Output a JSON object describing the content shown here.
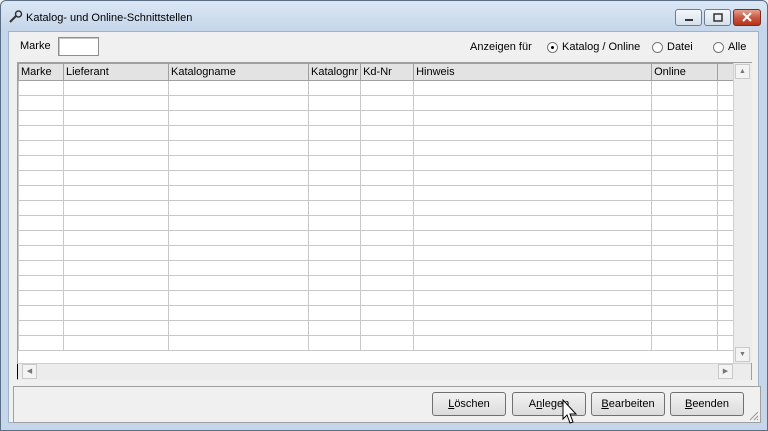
{
  "window": {
    "title": "Katalog- und Online-Schnittstellen"
  },
  "filter": {
    "marke_label": "Marke",
    "anzeigen_label": "Anzeigen für",
    "options": [
      {
        "label": "Katalog / Online",
        "checked": true
      },
      {
        "label": "Datei",
        "checked": false
      },
      {
        "label": "Alle",
        "checked": false
      }
    ]
  },
  "table": {
    "columns": [
      "Marke",
      "Lieferant",
      "Katalogname",
      "Katalognr",
      "Kd-Nr",
      "Hinweis",
      "Online",
      ""
    ],
    "row_count": 18
  },
  "buttons": {
    "loeschen": {
      "first": "L",
      "rest": "öschen"
    },
    "anlegen": {
      "pre": "A",
      "u": "n",
      "rest": "legen"
    },
    "bearbeiten": {
      "first": "B",
      "rest": "earbeiten"
    },
    "beenden": {
      "first": "B",
      "rest": "eenden"
    }
  }
}
